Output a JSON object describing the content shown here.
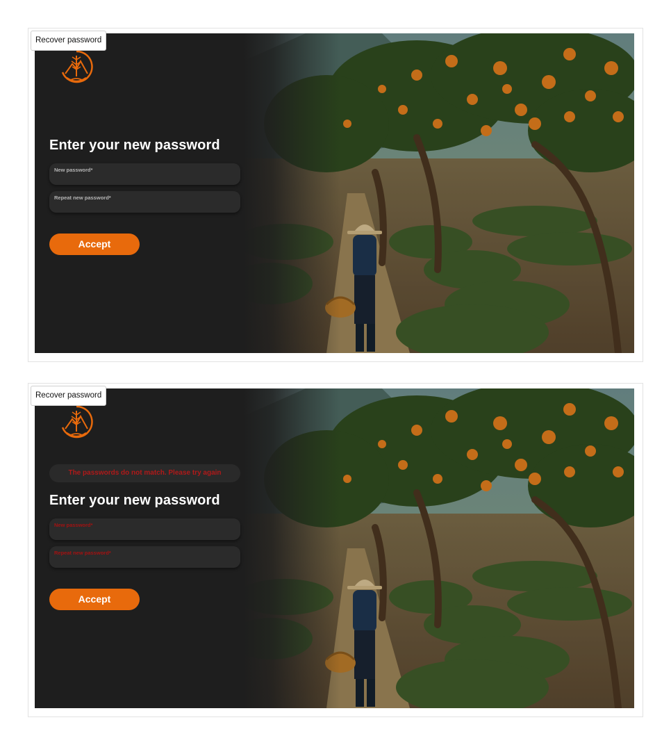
{
  "frames": [
    {
      "label": "Recover password",
      "title": "Enter your new password",
      "fields": [
        {
          "label": "New password*"
        },
        {
          "label": "Repeat new password*"
        }
      ],
      "accept_label": "Accept"
    },
    {
      "label": "Recover password",
      "error_message": "The passwords do not match. Please try again",
      "title": "Enter your new password",
      "fields": [
        {
          "label": "New password*"
        },
        {
          "label": "Repeat new password*"
        }
      ],
      "accept_label": "Accept"
    }
  ],
  "colors": {
    "accent": "#e86a0c",
    "panel_bg": "#1e1e1e",
    "field_bg": "#2b2b2b",
    "error": "#b01919"
  },
  "icons": {
    "logo": "orchard-tree-logo-icon"
  }
}
